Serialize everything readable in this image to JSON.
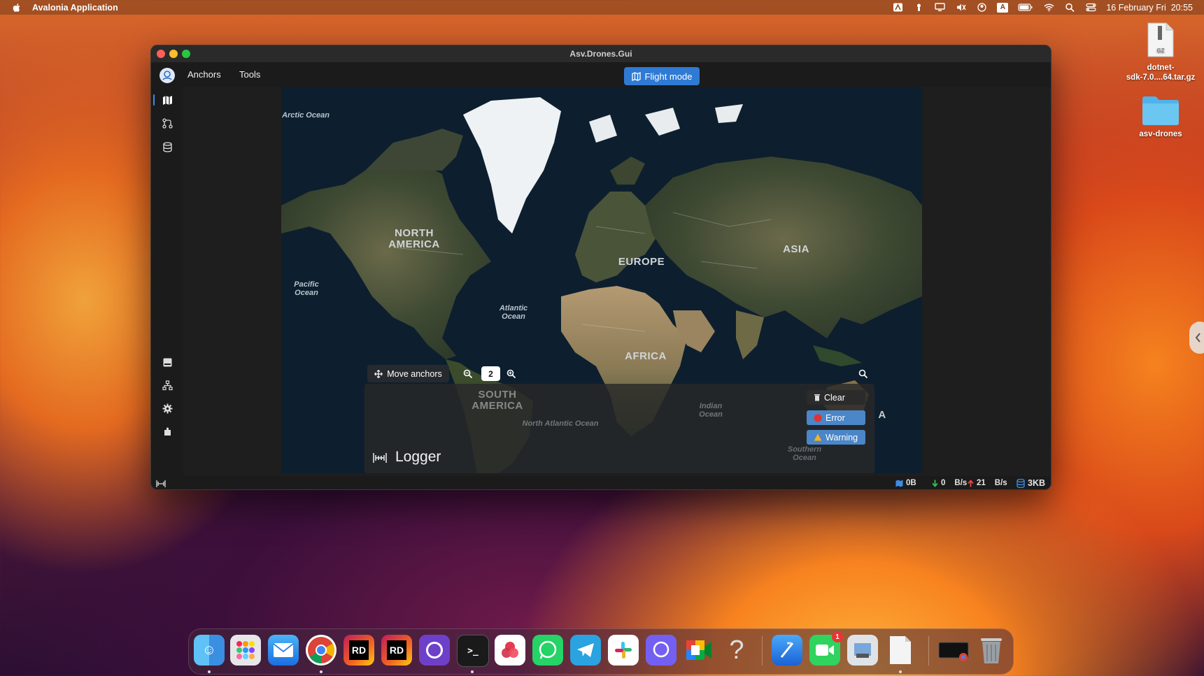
{
  "menubar": {
    "app_name": "Avalonia Application",
    "datetime": "16 February Fri  20:55",
    "status_icons": [
      "autodesk-icon",
      "cat-icon",
      "display-icon",
      "mute-icon",
      "user-icon",
      "keyboard-input-icon",
      "battery-icon",
      "wifi-icon",
      "spotlight-icon",
      "control-center-icon"
    ],
    "input_source": "A"
  },
  "desktop": {
    "items": [
      {
        "label": "dotnet-sdk-7.0....64.tar.gz",
        "line1": "dotnet-",
        "line2": "sdk-7.0....64.tar.gz",
        "icon": "archive-file-icon",
        "badge": "GZ"
      },
      {
        "label": "asv-drones",
        "icon": "folder-icon"
      }
    ]
  },
  "window": {
    "title": "Asv.Drones.Gui",
    "menu": [
      {
        "label": "Anchors"
      },
      {
        "label": "Tools"
      }
    ],
    "flight_mode_label": "Flight mode",
    "sidebar_top": [
      "map-icon",
      "route-icon",
      "database-icon"
    ],
    "sidebar_bottom": [
      "log-panel-icon",
      "network-icon",
      "settings-icon",
      "plugins-icon"
    ]
  },
  "map": {
    "labels": {
      "arctic": "Arctic Ocean",
      "north_america": "NORTH AMERICA",
      "pacific": "Pacific Ocean",
      "atlantic": "Atlantic Ocean",
      "europe": "EUROPE",
      "asia": "ASIA",
      "africa": "AFRICA",
      "south_america": "SOUTH AMERICA",
      "north_atlantic": "North Atlantic Ocean",
      "indian": "Indian Ocean",
      "southern": "Southern Ocean",
      "australia_partial": "A"
    },
    "move_anchors_label": "Move anchors",
    "zoom_level": "2"
  },
  "logger": {
    "title": "Logger",
    "buttons": [
      {
        "label": "Clear",
        "icon": "trash-icon"
      },
      {
        "label": "Error",
        "icon": "error-icon",
        "color": "#4a86c8"
      },
      {
        "label": "Warning",
        "icon": "warning-icon",
        "color": "#4a86c8"
      }
    ]
  },
  "status": {
    "map_cache": "0B",
    "down_rate": "0",
    "down_unit": "B/s",
    "up_rate": "21",
    "up_unit": "B/s",
    "storage": "3KB"
  },
  "dock": {
    "apps": [
      "Finder",
      "Launchpad",
      "Mail",
      "Chrome",
      "Rider",
      "Rider",
      "GitHub Desktop",
      "Terminal",
      "Affinity",
      "WhatsApp",
      "Telegram",
      "Slack",
      "Viber",
      "Google Meet",
      "Help",
      "Xcode",
      "FaceTime",
      "Preview",
      "Document",
      "Chrome Window",
      "Trash"
    ],
    "facetime_badge": "1",
    "rider_label": "RD"
  },
  "colors": {
    "accent": "#2f7ad4",
    "window_bg": "#1e1e1e",
    "error": "#e0332f",
    "warning": "#f2b124"
  }
}
